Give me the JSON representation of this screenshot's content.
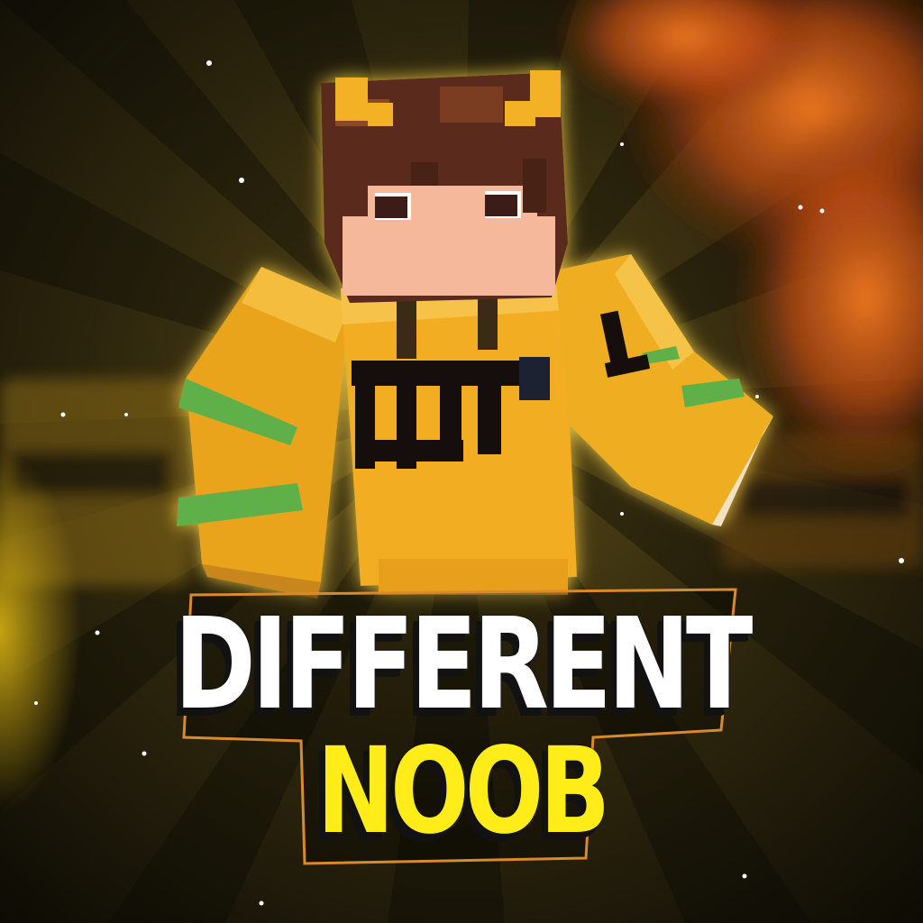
{
  "title": {
    "line1": "DIFFERENT",
    "line2": "NOOB"
  },
  "colors": {
    "line1": "#ffffff",
    "line2": "#ffec18",
    "frame_outline": "#d98a2a",
    "skin_hoodie": "#f0b12a",
    "skin_hair": "#5a2b1c",
    "skin_band_green": "#5fb04a",
    "smoke": "#e0651a"
  },
  "icons": [
    "minecraft-character",
    "sparkle",
    "smoke-cloud",
    "sunburst-rays"
  ]
}
